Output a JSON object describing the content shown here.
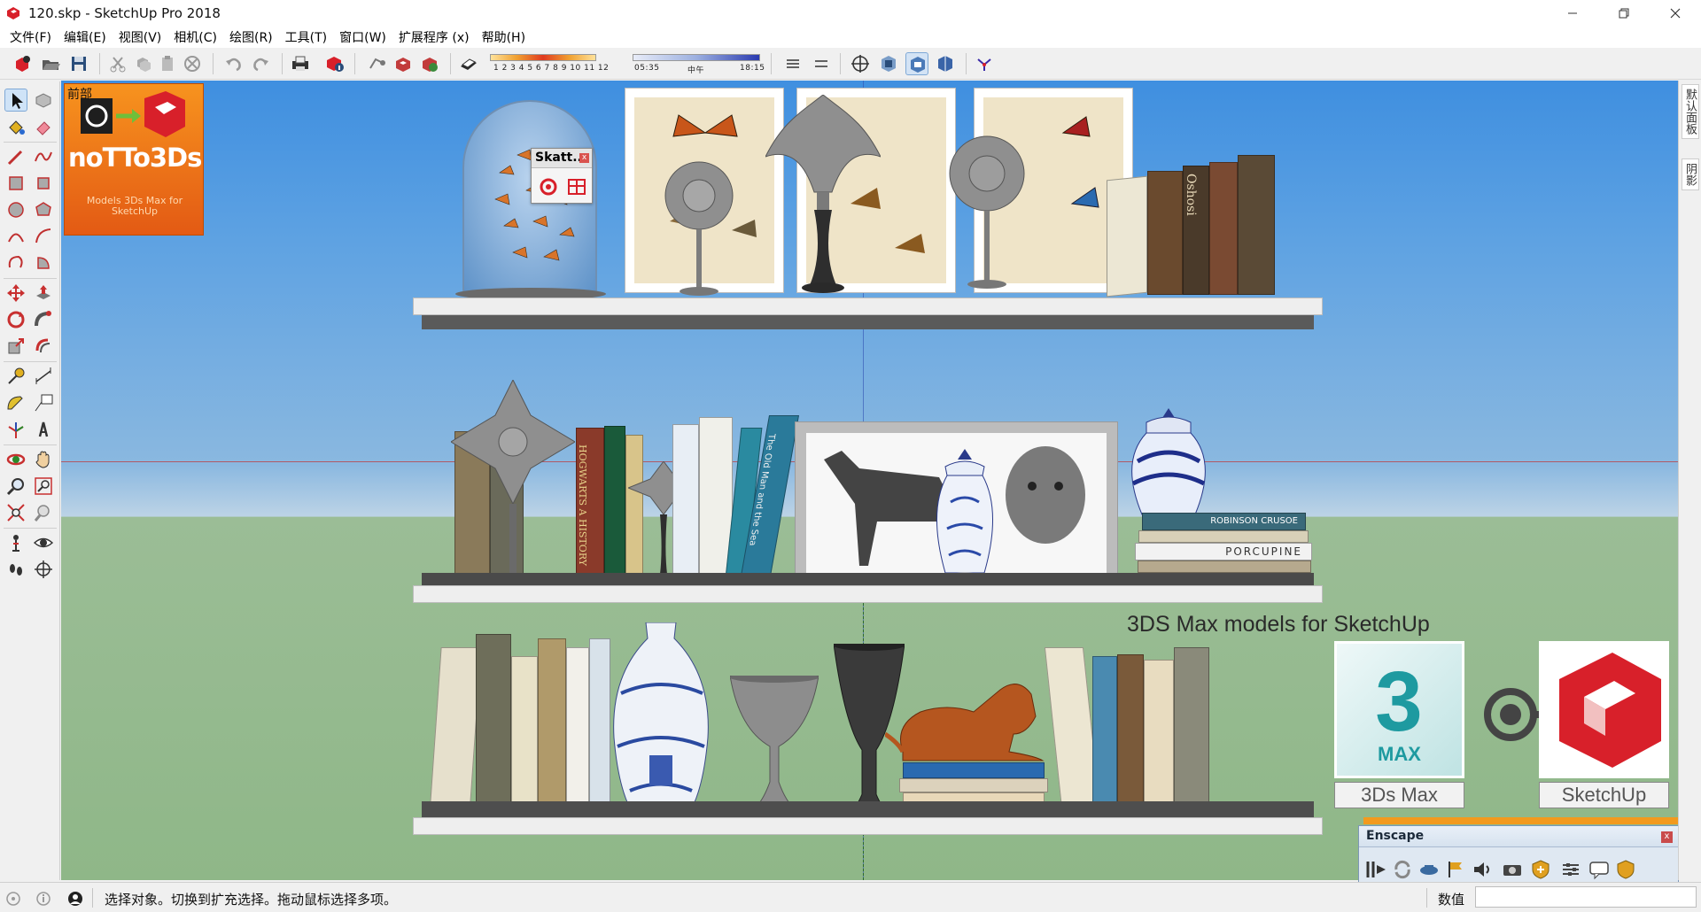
{
  "window": {
    "title": "120.skp - SketchUp Pro 2018"
  },
  "menu": [
    {
      "label": "文件(F)"
    },
    {
      "label": "编辑(E)"
    },
    {
      "label": "视图(V)"
    },
    {
      "label": "相机(C)"
    },
    {
      "label": "绘图(R)"
    },
    {
      "label": "工具(T)"
    },
    {
      "label": "窗口(W)"
    },
    {
      "label": "扩展程序 (x)"
    },
    {
      "label": "帮助(H)"
    }
  ],
  "toolbar": {
    "shadow_months": "1 2 3 4 5 6 7 8 9 10 11 12",
    "shadow_time_start": "05:35",
    "shadow_time_mid": "中午",
    "shadow_time_end": "18:15"
  },
  "viewport": {
    "scene_label": "前部",
    "logo_title": "noTTo3Ds",
    "logo_sub": "Models 3Ds Max for SketchUp",
    "skatter_panel_title": "Skatt...",
    "promo_title": "3DS Max models for SketchUp",
    "promo_left_caption": "3Ds Max",
    "promo_left_tile_text": "MAX",
    "promo_right_caption": "SketchUp",
    "book_titles": {
      "b1": "ROBINSON CRUSOE",
      "b2": "PORCUPINE",
      "b3": "HOGWARTS A HISTORY",
      "b4": "The Old Man and the Sea",
      "b5": "Oshosi"
    }
  },
  "enscape": {
    "title": "Enscape"
  },
  "right_panel": {
    "tab1": "默认面板",
    "tab2": "阴影"
  },
  "status": {
    "message": "选择对象。切换到扩充选择。拖动鼠标选择多项。",
    "measure_label": "数值",
    "measure_value": ""
  },
  "colors": {
    "sky_top": "#3f8fe0",
    "ground": "#8fb788",
    "logo_orange": "#f7931e",
    "shelf": "#eeeeee",
    "shelf_edge": "#5a5a5a",
    "accent_red": "#d8202a"
  }
}
